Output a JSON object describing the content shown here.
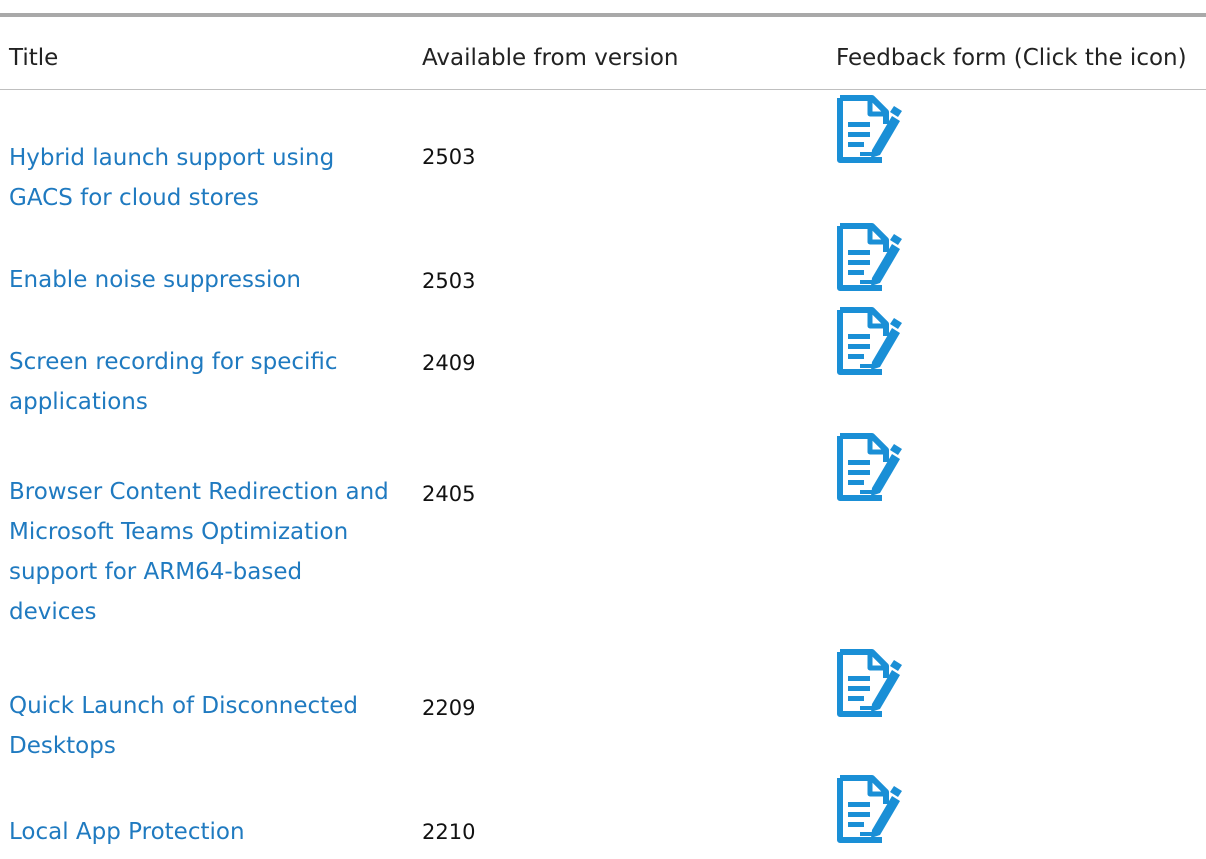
{
  "table": {
    "headers": {
      "title": "Title",
      "version": "Available from version",
      "feedback": "Feedback form (Click the icon)"
    },
    "rows": [
      {
        "title": "Hybrid launch support using GACS for cloud stores",
        "version": "2503",
        "feedback_icon": "form-edit-icon"
      },
      {
        "title": "Enable noise suppression",
        "version": "2503",
        "feedback_icon": "form-edit-icon"
      },
      {
        "title": "Screen recording for specific applications",
        "version": "2409",
        "feedback_icon": "form-edit-icon"
      },
      {
        "title": "Browser Content Redirection and Microsoft Teams Optimization support for ARM64-based devices",
        "version": "2405",
        "feedback_icon": "form-edit-icon"
      },
      {
        "title": "Quick Launch of Disconnected Desktops",
        "version": "2209",
        "feedback_icon": "form-edit-icon"
      },
      {
        "title": "Local App Protection",
        "version": "2210",
        "feedback_icon": "form-edit-icon"
      }
    ]
  },
  "colors": {
    "link": "#1f7ac0",
    "icon": "#1a8fd6",
    "rule": "#a9a9a9"
  }
}
